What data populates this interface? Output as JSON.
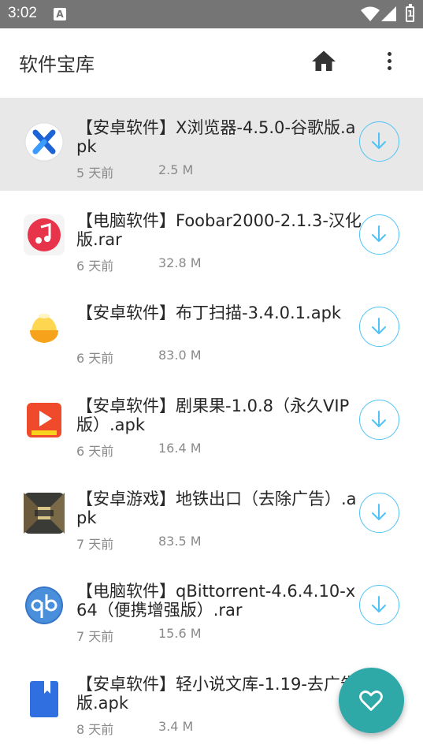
{
  "status_bar": {
    "time": "3:02",
    "notification": "A",
    "battery": "1"
  },
  "app_bar": {
    "title": "软件宝库",
    "home_icon": "home-icon",
    "more_icon": "more-vertical-icon"
  },
  "items": [
    {
      "title": "【安卓软件】X浏览器-4.5.0-谷歌版.apk",
      "age": "5 天前",
      "size": "2.5 M",
      "icon": "x-browser-icon",
      "selected": true
    },
    {
      "title": "【电脑软件】Foobar2000-2.1.3-汉化版.rar",
      "age": "6 天前",
      "size": "32.8 M",
      "icon": "music-note-icon",
      "selected": false
    },
    {
      "title": "【安卓软件】布丁扫描-3.4.0.1.apk",
      "age": "6 天前",
      "size": "83.0 M",
      "icon": "pudding-icon",
      "selected": false
    },
    {
      "title": "【安卓软件】剧果果-1.0.8（永久VIP版）.apk",
      "age": "6 天前",
      "size": "16.4 M",
      "icon": "play-icon",
      "selected": false
    },
    {
      "title": "【安卓游戏】地铁出口（去除广告）.apk",
      "age": "7 天前",
      "size": "83.5 M",
      "icon": "exit-subway-icon",
      "selected": false
    },
    {
      "title": "【电脑软件】qBittorrent-4.6.4.10-x64（便携增强版）.rar",
      "age": "7 天前",
      "size": "15.6 M",
      "icon": "qb-icon",
      "selected": false
    },
    {
      "title": "【安卓软件】轻小说文库-1.19-去广告版.apk",
      "age": "8 天前",
      "size": "3.4 M",
      "icon": "book-icon",
      "selected": false
    }
  ],
  "fab": {
    "icon": "heart-icon"
  },
  "colors": {
    "status_bar": "#757575",
    "accent": "#2fa8a8",
    "download_ring": "#4fc3f7",
    "selected_row": "#e8e8e8"
  }
}
